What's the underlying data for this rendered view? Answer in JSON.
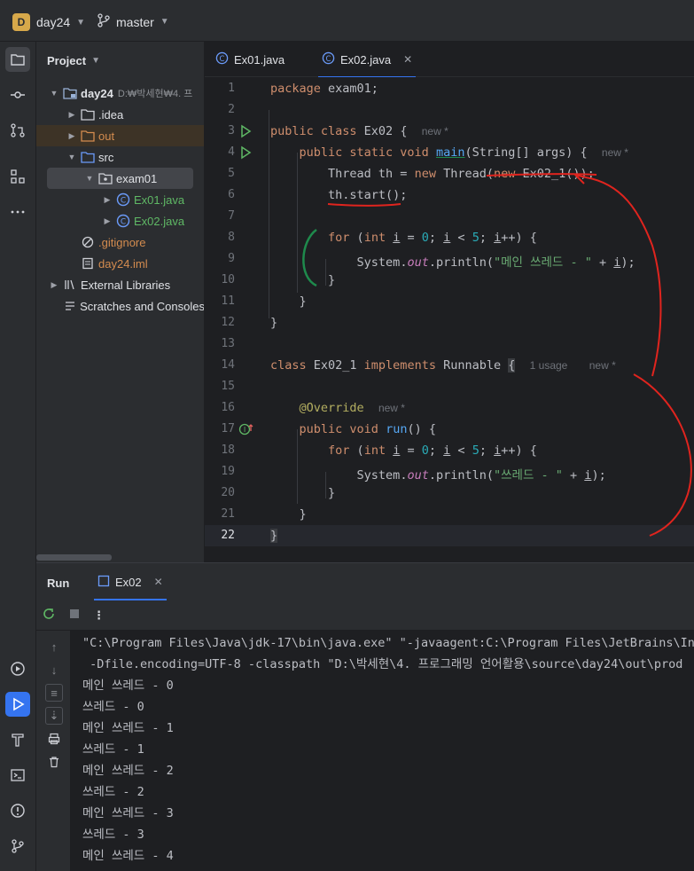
{
  "titlebar": {
    "project_badge": "D",
    "project_name": "day24",
    "branch": "master"
  },
  "project_panel": {
    "title": "Project",
    "tree": [
      {
        "label": "day24",
        "path_hint": "D:₩박세현₩4. 프",
        "icon": "module-folder-icon"
      },
      {
        "label": ".idea",
        "icon": "folder-icon"
      },
      {
        "label": "out",
        "icon": "folder-icon"
      },
      {
        "label": "src",
        "icon": "source-folder-icon"
      },
      {
        "label": "exam01",
        "icon": "package-icon"
      },
      {
        "label": "Ex01.java",
        "icon": "java-class-icon"
      },
      {
        "label": "Ex02.java",
        "icon": "java-class-icon"
      },
      {
        "label": ".gitignore",
        "icon": "ignore-file-icon"
      },
      {
        "label": "day24.iml",
        "icon": "iml-file-icon"
      },
      {
        "label": "External Libraries",
        "icon": "library-icon"
      },
      {
        "label": "Scratches and Consoles",
        "icon": "scratches-icon"
      }
    ]
  },
  "editor": {
    "tabs": [
      {
        "label": "Ex01.java",
        "active": false
      },
      {
        "label": "Ex02.java",
        "active": true
      }
    ],
    "line_numbers": [
      "1",
      "2",
      "3",
      "4",
      "5",
      "6",
      "7",
      "8",
      "9",
      "10",
      "11",
      "12",
      "13",
      "14",
      "15",
      "16",
      "17",
      "18",
      "19",
      "20",
      "21",
      "22"
    ],
    "hints": {
      "new": "new *",
      "usage": "1 usage",
      "usage_new": "new *"
    },
    "code": {
      "l1_kw": "package",
      "l1_rest": " exam01;",
      "l3_kw": "public class",
      "l3_rest": " Ex02 {",
      "l4_kw1": "public static void",
      "l4_fn": "main",
      "l4_rest": "(String[] args) {",
      "l5_a": "Thread th = ",
      "l5_kw": "new",
      "l5_b": " Thread(",
      "l5_kw2": "new",
      "l5_c": " Ex02_1());",
      "l6": "th.start();",
      "l8_kw": "for",
      "l8_a": " (",
      "l8_kw2": "int",
      "l8_b": " ",
      "l8_i1": "i",
      "l8_c": " = ",
      "l8_n1": "0",
      "l8_d": "; ",
      "l8_i2": "i",
      "l8_e": " < ",
      "l8_n2": "5",
      "l8_f": "; ",
      "l8_i3": "i",
      "l8_g": "++) {",
      "l9_a": "System.",
      "l9_out": "out",
      "l9_b": ".println(",
      "l9_str": "\"메인 쓰레드 - \"",
      "l9_c": " + ",
      "l9_i": "i",
      "l9_d": ");",
      "close_brace": "}",
      "l14_kw": "class",
      "l14_a": " Ex02_1 ",
      "l14_kw2": "implements",
      "l14_b": " Runnable ",
      "l14_brace": "{",
      "l16_ann": "@Override",
      "l17_kw": "public void",
      "l17_fn": "run",
      "l17_rest": "() {",
      "l19_str": "\"쓰레드 - \""
    }
  },
  "run_panel": {
    "title": "Run",
    "tab": "Ex02",
    "console": [
      "\"C:\\Program Files\\Java\\jdk-17\\bin\\java.exe\" \"-javaagent:C:\\Program Files\\JetBrains\\Int",
      " -Dfile.encoding=UTF-8 -classpath \"D:\\박세현\\4. 프로그래밍 언어활용\\source\\day24\\out\\prod",
      "메인 쓰레드 - 0",
      "쓰레드 - 0",
      "메인 쓰레드 - 1",
      "쓰레드 - 1",
      "메인 쓰레드 - 2",
      "쓰레드 - 2",
      "메인 쓰레드 - 3",
      "쓰레드 - 3",
      "메인 쓰레드 - 4"
    ]
  },
  "colors": {
    "accent": "#3574f0",
    "annotation_red": "#e0241e",
    "annotation_green": "#1e8a4c"
  }
}
